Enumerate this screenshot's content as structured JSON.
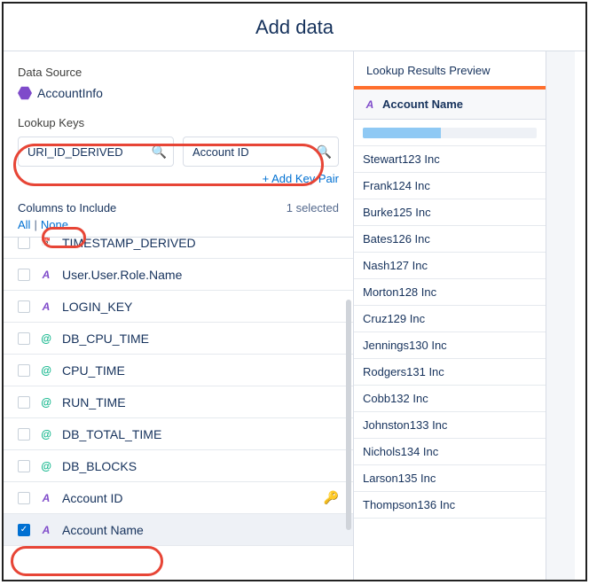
{
  "title": "Add data",
  "left": {
    "dataSourceLabel": "Data Source",
    "dataSourceName": "AccountInfo",
    "lookupKeysLabel": "Lookup Keys",
    "key1": "URI_ID_DERIVED",
    "key2": "Account ID",
    "addKey": "+ Add Key Pair",
    "columnsLabel": "Columns to Include",
    "selected": "1 selected",
    "all": "All",
    "none": "None",
    "columns": [
      {
        "name": "TIMESTAMP_DERIVED",
        "type": "date",
        "checked": false
      },
      {
        "name": "User.User.Role.Name",
        "type": "text",
        "checked": false
      },
      {
        "name": "LOGIN_KEY",
        "type": "text",
        "checked": false
      },
      {
        "name": "DB_CPU_TIME",
        "type": "num",
        "checked": false
      },
      {
        "name": "CPU_TIME",
        "type": "num",
        "checked": false
      },
      {
        "name": "RUN_TIME",
        "type": "num",
        "checked": false
      },
      {
        "name": "DB_TOTAL_TIME",
        "type": "num",
        "checked": false
      },
      {
        "name": "DB_BLOCKS",
        "type": "num",
        "checked": false
      },
      {
        "name": "Account ID",
        "type": "text",
        "checked": false,
        "key": true,
        "orange": true
      },
      {
        "name": "Account Name",
        "type": "text",
        "checked": true,
        "highlight": true
      }
    ]
  },
  "right": {
    "previewLabel": "Lookup Results Preview",
    "column": "Account Name",
    "rows": [
      "Stewart123 Inc",
      "Frank124 Inc",
      "Burke125 Inc",
      "Bates126 Inc",
      "Nash127 Inc",
      "Morton128 Inc",
      "Cruz129 Inc",
      "Jennings130 Inc",
      "Rodgers131 Inc",
      "Cobb132 Inc",
      "Johnston133 Inc",
      "Nichols134 Inc",
      "Larson135 Inc",
      "Thompson136 Inc"
    ]
  }
}
